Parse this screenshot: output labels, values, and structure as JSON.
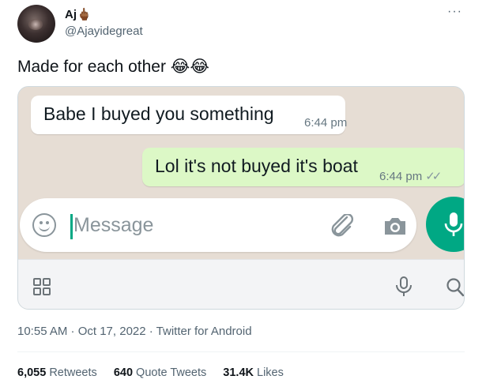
{
  "author": {
    "name": "Aj🖕🏾",
    "handle": "@Ajayidegreat"
  },
  "tweet": {
    "text": "Made for each other 😂😂",
    "timestamp": "10:55 AM · Oct 17, 2022",
    "separator": " · ",
    "source": "Twitter for Android"
  },
  "embedded_chat": {
    "incoming": {
      "text": "Babe I buyed you something",
      "time": "6:44 pm"
    },
    "outgoing": {
      "text": "Lol it's not buyed it's boat",
      "time": "6:44 pm",
      "read_ticks": "✓✓"
    },
    "input": {
      "placeholder": "Message",
      "value": ""
    },
    "colors": {
      "accent": "#00a884",
      "outgoing_bubble": "#dcf8c6",
      "incoming_bubble": "#ffffff"
    },
    "icons": [
      "emoji-icon",
      "paperclip-icon",
      "camera-icon",
      "microphone-icon",
      "keyboard-grid-icon",
      "keyboard-mic-icon",
      "search-icon"
    ]
  },
  "stats": {
    "retweets": {
      "count": "6,055",
      "label": "Retweets"
    },
    "quote_tweets": {
      "count": "640",
      "label": "Quote Tweets"
    },
    "likes": {
      "count": "31.4K",
      "label": "Likes"
    }
  },
  "more_menu": "···"
}
